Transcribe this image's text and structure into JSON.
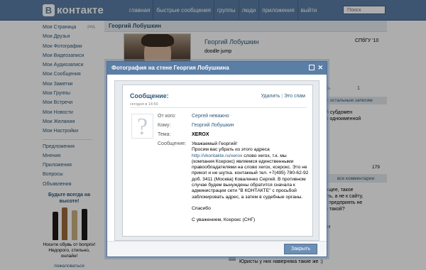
{
  "header": {
    "logo_mark": "В",
    "logo_text": "контакте",
    "nav": [
      "главная",
      "быстрые сообщения",
      "группы",
      "люди",
      "приложения",
      "выйти"
    ],
    "search_placeholder": "Поиск"
  },
  "sidebar": {
    "items": [
      {
        "label": "Моя Страница",
        "edit": "ред."
      },
      {
        "label": "Мои Друзья"
      },
      {
        "label": "Мои Фотографии"
      },
      {
        "label": "Мои Видеозаписи"
      },
      {
        "label": "Мои Аудиозаписи"
      },
      {
        "label": "Мои Сообщения"
      },
      {
        "label": "Мои Заметки"
      },
      {
        "label": "Мои Группы"
      },
      {
        "label": "Мои Встречи"
      },
      {
        "label": "Мои Новости"
      },
      {
        "label": "Мои Желания"
      },
      {
        "label": "Мои Настройки"
      }
    ],
    "extras": [
      "Предложения",
      "Мнения",
      "Приложения",
      "Вопросы",
      "Объявления"
    ],
    "ad": {
      "title": "Будьте всегда на высоте!",
      "text": "Носите обувь от bonprix! Недорого, стильно, онлайн!",
      "link": "пожаловаться",
      "boot_colors": [
        "#1e1a17",
        "#9a6a3b",
        "#c9b27e",
        "#1a1a1a"
      ]
    }
  },
  "profile": {
    "page_title": "Георгий Лобушкин",
    "name": "Георгий Лобушкин",
    "status": "doodle jump",
    "university": "СПбГУ '10",
    "behind_texts": {
      "b1": "ть",
      "b2": "1",
      "b3": "к остальным записям",
      "b4": "й субдомен",
      "b5": "у одноименной",
      "b6": "179",
      "b7": "все комментарии",
      "b8": "ющее, такое",
      "b9": "ать, а не к сайту,",
      "b10": "о предприять не",
      "b11": "м такой?",
      "b12": "ли",
      "b13": "Юристы у них наверняка такие же :)"
    }
  },
  "modal": {
    "title": "Фотография на стене Георгия Лобушкина",
    "message": {
      "heading": "Сообщение:",
      "date": "сегодня в 14:50",
      "delete": "Удалить",
      "separator": "|",
      "spam": "Это спам",
      "avatar_glyph": "?",
      "from_label": "От кого:",
      "from": "Сергей неважно",
      "to_label": "Кому:",
      "to": "Георгий Лобушкин",
      "subject_label": "Тема:",
      "subject": "XEROX",
      "body_label": "Сообщение:",
      "greeting": "Уважаемый Георгий!",
      "line1": "Просим вас убрать из этого адреса",
      "link": "http://vkontakte.ru/xerox",
      "line2": " слово xerox, т.к. мы (компания Ксерокс) являемся единственными правообладателями на слово xerox, ксерокс. Это не прикол и не шутка. контакный тел. +7(495) 780-62-92 доб. 3411 (Москва) Коваленко Сергей. В противном случае будем вынуждены обратится сначала к администрации сети \"В КОНТАКТЕ\" с просьбой заблокировать адрес, а затем в судебные органы.",
      "thanks": "Спасибо",
      "sign": "С уважением, Ксерокс (СНГ)"
    },
    "close_label": "Закрыть"
  }
}
